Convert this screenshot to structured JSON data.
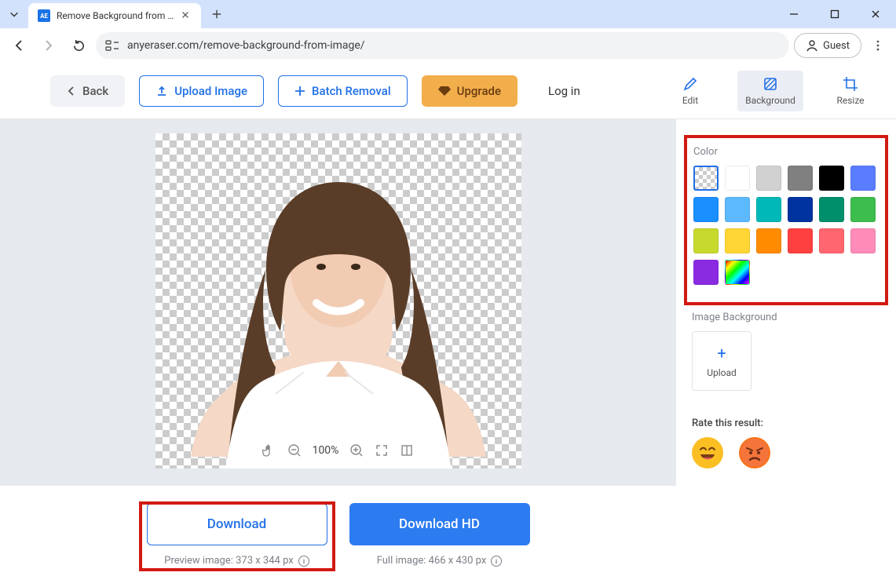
{
  "browser": {
    "tab_title": "Remove Background from Im",
    "url": "anyeraser.com/remove-background-from-image/",
    "guest_label": "Guest"
  },
  "header": {
    "back": "Back",
    "upload": "Upload Image",
    "batch": "Batch Removal",
    "upgrade": "Upgrade",
    "login": "Log in",
    "tools": {
      "edit": "Edit",
      "background": "Background",
      "resize": "Resize"
    }
  },
  "canvas": {
    "zoom": "100%"
  },
  "downloads": {
    "preview_btn": "Download",
    "preview_sub": "Preview image: 373 x 344 px",
    "hd_btn": "Download HD",
    "hd_sub": "Full image: 466 x 430 px"
  },
  "sidebar": {
    "color_title": "Color",
    "colors": [
      {
        "value": "transparent",
        "name": "transparent"
      },
      {
        "value": "#ffffff",
        "name": "white"
      },
      {
        "value": "#d1d1d1",
        "name": "light-gray"
      },
      {
        "value": "#808080",
        "name": "gray"
      },
      {
        "value": "#000000",
        "name": "black"
      },
      {
        "value": "#5a7dff",
        "name": "indigo"
      },
      {
        "value": "#1a8fff",
        "name": "blue"
      },
      {
        "value": "#5cb8ff",
        "name": "sky"
      },
      {
        "value": "#00b8b8",
        "name": "teal"
      },
      {
        "value": "#0033a0",
        "name": "navy"
      },
      {
        "value": "#008f6b",
        "name": "emerald"
      },
      {
        "value": "#3dbd4e",
        "name": "green"
      },
      {
        "value": "#c8d92e",
        "name": "lime"
      },
      {
        "value": "#ffd633",
        "name": "yellow"
      },
      {
        "value": "#ff8c00",
        "name": "orange"
      },
      {
        "value": "#ff4040",
        "name": "red"
      },
      {
        "value": "#ff6670",
        "name": "salmon"
      },
      {
        "value": "#ff8cb8",
        "name": "pink"
      },
      {
        "value": "#8a2be2",
        "name": "purple"
      },
      {
        "value": "rainbow",
        "name": "custom"
      }
    ],
    "image_bg_title": "Image Background",
    "upload_label": "Upload",
    "rate_title": "Rate this result:"
  }
}
